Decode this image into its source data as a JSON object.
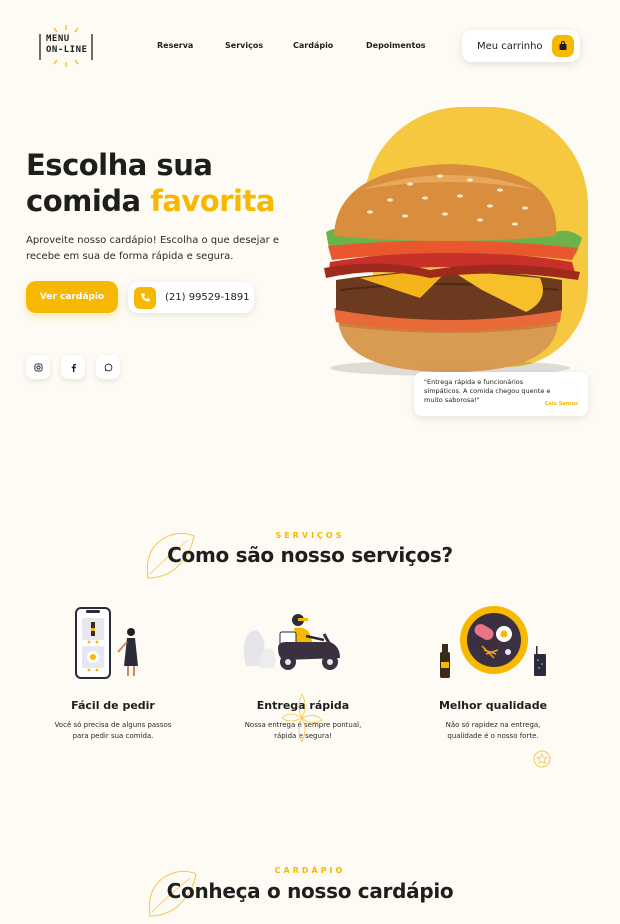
{
  "header": {
    "logo_line1": "MENU",
    "logo_line2": "ON-LINE",
    "nav": [
      "Reserva",
      "Serviços",
      "Cardápio",
      "Depoimentos"
    ],
    "cart_label": "Meu carrinho"
  },
  "hero": {
    "title_line1": "Escolha sua",
    "title_line2": "comida ",
    "title_accent": "favorita",
    "description": "Aproveite nosso cardápio! Escolha o que desejar e recebe em sua de forma rápida e segura.",
    "cta_label": "Ver cardápio",
    "phone": "(21) 99529-1891",
    "testimonial_text": "\"Entrega rápida e funcionários simpáticos. A comida chegou quente e muito saborosa!\"",
    "testimonial_author": "Caio Santos"
  },
  "services": {
    "kicker": "SERVIÇOS",
    "title": "Como são nosso serviços?",
    "items": [
      {
        "title": "Fácil de pedir",
        "text": "Você só precisa de alguns passos para pedir sua comida."
      },
      {
        "title": "Entrega rápida",
        "text": "Nossa entrega é sempre pontual, rápida e segura!"
      },
      {
        "title": "Melhor qualidade",
        "text": "Não só rapidez na entrega, qualidade é o nosso forte."
      }
    ]
  },
  "menu": {
    "kicker": "CARDÁPIO",
    "title": "Conheça o nosso cardápio"
  },
  "colors": {
    "accent": "#f6b800",
    "background": "#fdfbf3",
    "text": "#1e1e1e"
  },
  "icons": [
    "cart-icon",
    "phone-icon",
    "instagram-icon",
    "facebook-icon",
    "whatsapp-icon",
    "star-icon"
  ]
}
